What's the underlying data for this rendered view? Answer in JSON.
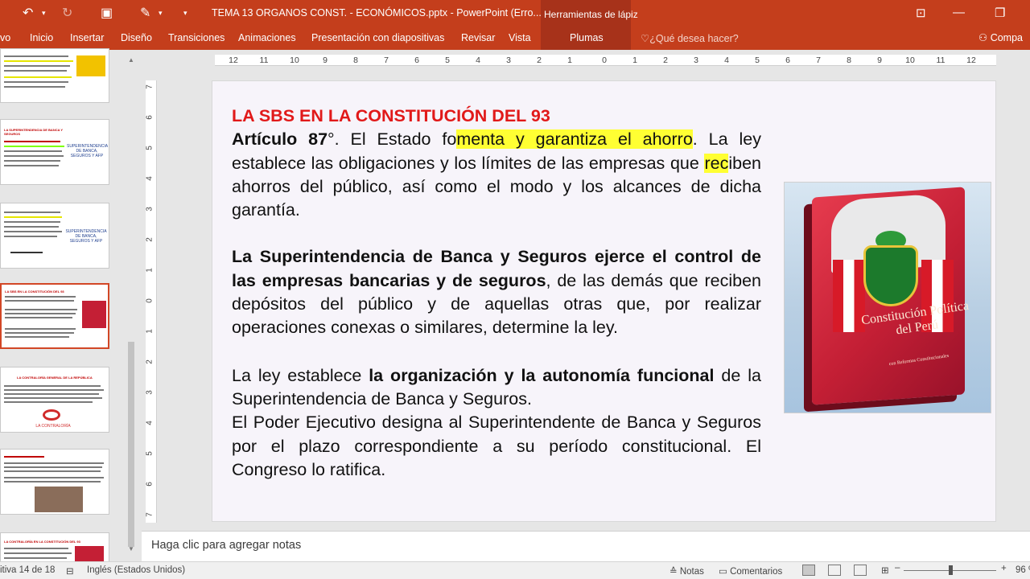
{
  "window": {
    "title": "TEMA 13 ORGANOS CONST. - ECONÓMICOS.pptx - PowerPoint (Erro...",
    "context_tab": "Herramientas de lápiz"
  },
  "ribbon": {
    "tabs": [
      "vo",
      "Inicio",
      "Insertar",
      "Diseño",
      "Transiciones",
      "Animaciones",
      "Presentación con diapositivas",
      "Revisar",
      "Vista",
      "Plumas"
    ],
    "tell_me": "¿Qué desea hacer?",
    "share": "Compa"
  },
  "ruler": {
    "h_ticks": [
      "12",
      "11",
      "10",
      "9",
      "8",
      "7",
      "6",
      "5",
      "4",
      "3",
      "2",
      "1",
      "0",
      "1",
      "2",
      "3",
      "4",
      "5",
      "6",
      "7",
      "8",
      "9",
      "10",
      "11",
      "12"
    ],
    "v_ticks": [
      "7",
      "6",
      "5",
      "4",
      "3",
      "2",
      "1",
      "0",
      "1",
      "2",
      "3",
      "4",
      "5",
      "6",
      "7"
    ]
  },
  "slide": {
    "heading": "LA SBS EN LA CONSTITUCIÓN DEL 93",
    "p1": {
      "bold": "Artículo 87",
      "a": "°. El Estado fo",
      "hl": "menta y garantiza el ahorro",
      "b": ". La ley establece las obligaciones y los límites de las empresas que ",
      "hl2": "rec",
      "c": "iben ahorros del público, así como el modo y los alcances de dicha garantía."
    },
    "p2": {
      "bold1": "La Superintendencia de Banca y Seguros ejerce el control de las empresas bancarias y de seguros",
      "rest": ", de las demás que reciben depósitos del público y de aquellas otras que, por realizar operaciones conexas o similares, determine la ley."
    },
    "p3": {
      "a": "La ley establece ",
      "bold": "la organización y la autonomía funcional",
      "b": " de la Superintendencia de Banca y Seguros."
    },
    "p4": "El Poder Ejecutivo designa al Superintendente de Banca y Seguros por el plazo  correspondiente a su período constitucional. El Congreso lo ratifica.",
    "book_caption": "Constitución Política del Perú",
    "book_sub": "con Reformas Constitucionales"
  },
  "thumbnails": {
    "t1_title": "LA SUPERINTENDENCIA DE BANCA Y SEGUROS",
    "t1_logo": "SUPERINTENDENCIA DE BANCA, SEGUROS Y AFP",
    "t2_logo": "SUPERINTENDENCIA DE BANCA, SEGUROS Y AFP",
    "t3_title": "LA SBS EN LA CONSTITUCIÓN DEL 93",
    "t4_title": "LA CONTRALORÍA GENERAL DE LA REPÚBLICA",
    "t4_logo": "LA CONTRALORÍA",
    "t6_title": "LA CONTRALORÍA EN LA CONSTITUCIÓN DEL 93"
  },
  "notes": {
    "placeholder": "Haga clic para agregar notas"
  },
  "status": {
    "slide_info": "itiva 14 de 18",
    "language": "Inglés (Estados Unidos)",
    "notes_btn": "Notas",
    "comments_btn": "Comentarios",
    "zoom": "96 %"
  }
}
